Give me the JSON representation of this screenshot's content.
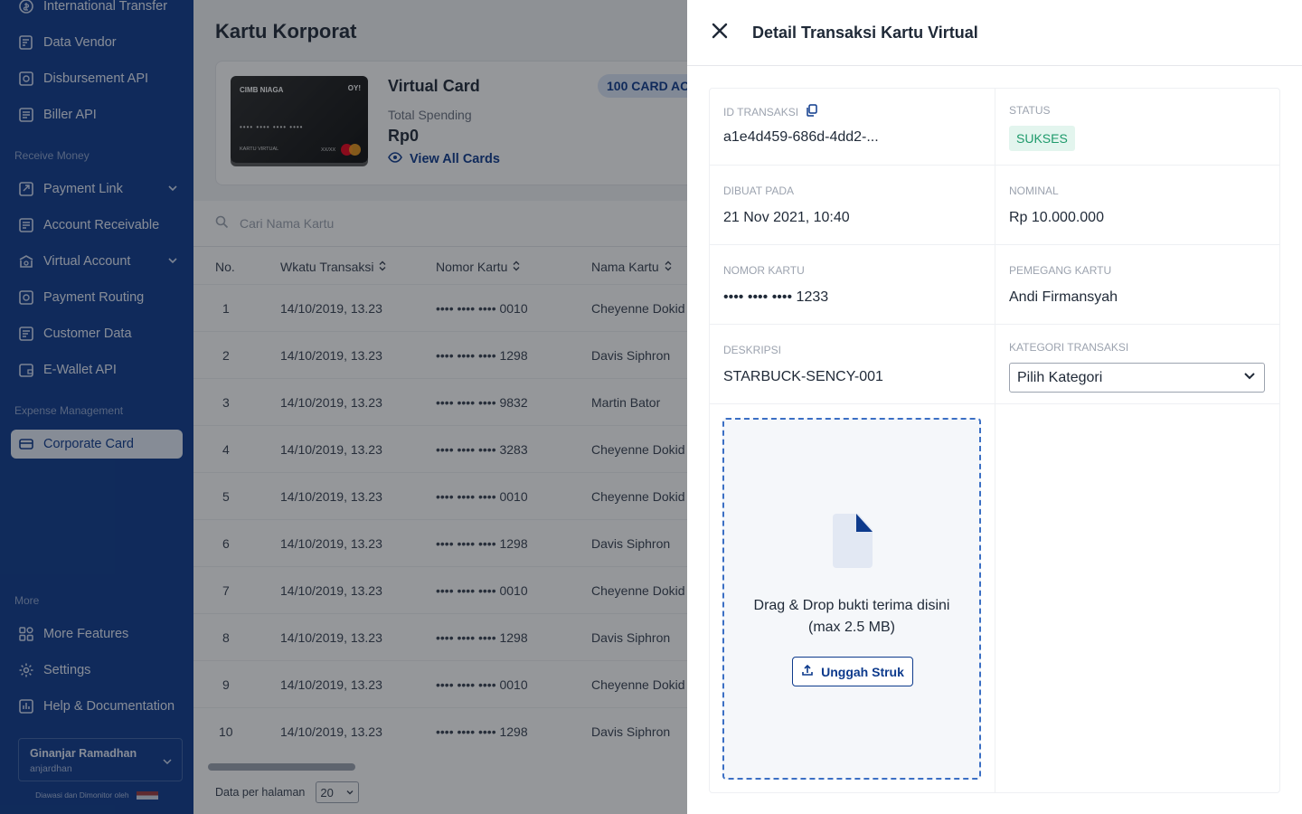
{
  "sidebar": {
    "items_top": [
      {
        "label": "International Transfer",
        "icon": "transfer-icon"
      },
      {
        "label": "Data Vendor",
        "icon": "vendor-icon"
      },
      {
        "label": "Disbursement API",
        "icon": "api-icon"
      },
      {
        "label": "Biller API",
        "icon": "biller-icon"
      }
    ],
    "section_receive": "Receive Money",
    "items_receive": [
      {
        "label": "Payment Link",
        "icon": "link-icon"
      },
      {
        "label": "Account Receivable",
        "icon": "receivable-icon"
      },
      {
        "label": "Virtual Account",
        "icon": "virtual-account-icon"
      },
      {
        "label": "Payment Routing",
        "icon": "routing-icon"
      },
      {
        "label": "Customer Data",
        "icon": "customer-icon"
      },
      {
        "label": "E-Wallet API",
        "icon": "wallet-icon"
      }
    ],
    "section_expense": "Expense Management",
    "active_item": {
      "label": "Corporate Card",
      "icon": "card-icon"
    },
    "section_more": "More",
    "items_more": [
      {
        "label": "More Features",
        "icon": "grid-icon"
      },
      {
        "label": "Settings",
        "icon": "gear-icon"
      },
      {
        "label": "Help & Documentation",
        "icon": "help-icon"
      }
    ],
    "user": {
      "name": "Ginanjar Ramadhan",
      "handle": "anjardhan"
    },
    "monitor_text": "Diawasi dan Dimonitor oleh"
  },
  "main": {
    "title": "Kartu Korporat",
    "card": {
      "brand": "CIMB NIAGA",
      "issuer": "OY!",
      "number_mask": "•••• •••• •••• ••••",
      "label": "KARTU VIRTUAL",
      "expiry": "XX/XX",
      "title": "Virtual Card",
      "badge": "100 CARD AC",
      "spending_label": "Total Spending",
      "spending_value": "Rp0",
      "view_all": "View All Cards"
    },
    "search_placeholder": "Cari Nama Kartu",
    "columns": [
      "No.",
      "Wkatu Transaksi",
      "Nomor Kartu",
      "Nama Kartu"
    ],
    "rows": [
      {
        "no": "1",
        "time": "14/10/2019, 13.23",
        "card": "•••• •••• •••• 0010",
        "name": "Cheyenne Dokid"
      },
      {
        "no": "2",
        "time": "14/10/2019, 13.23",
        "card": "•••• •••• •••• 1298",
        "name": "Davis Siphron"
      },
      {
        "no": "3",
        "time": "14/10/2019, 13.23",
        "card": "•••• •••• •••• 9832",
        "name": "Martin Bator"
      },
      {
        "no": "4",
        "time": "14/10/2019, 13.23",
        "card": "•••• •••• •••• 3283",
        "name": "Cheyenne Dokid"
      },
      {
        "no": "5",
        "time": "14/10/2019, 13.23",
        "card": "•••• •••• •••• 0010",
        "name": "Cheyenne Dokid"
      },
      {
        "no": "6",
        "time": "14/10/2019, 13.23",
        "card": "•••• •••• •••• 1298",
        "name": "Davis Siphron"
      },
      {
        "no": "7",
        "time": "14/10/2019, 13.23",
        "card": "•••• •••• •••• 0010",
        "name": "Cheyenne Dokid"
      },
      {
        "no": "8",
        "time": "14/10/2019, 13.23",
        "card": "•••• •••• •••• 1298",
        "name": "Davis Siphron"
      },
      {
        "no": "9",
        "time": "14/10/2019, 13.23",
        "card": "•••• •••• •••• 0010",
        "name": "Cheyenne Dokid"
      },
      {
        "no": "10",
        "time": "14/10/2019, 13.23",
        "card": "•••• •••• •••• 1298",
        "name": "Davis Siphron"
      }
    ],
    "per_page_label": "Data per halaman",
    "per_page_value": "20"
  },
  "drawer": {
    "title": "Detail Transaksi Kartu Virtual",
    "id_label": "ID TRANSAKSI",
    "id_value": "a1e4d459-686d-4dd2-...",
    "status_label": "STATUS",
    "status_value": "SUKSES",
    "created_label": "DIBUAT PADA",
    "created_value": "21 Nov 2021, 10:40",
    "nominal_label": "NOMINAL",
    "nominal_value": "Rp 10.000.000",
    "card_label": "NOMOR KARTU",
    "card_value": "•••• •••• •••• 1233",
    "holder_label": "PEMEGANG KARTU",
    "holder_value": "Andi Firmansyah",
    "desc_label": "DESKRIPSI",
    "desc_value": "STARBUCK-SENCY-001",
    "category_label": "KATEGORI TRANSAKSI",
    "category_value": "Pilih Kategori",
    "drop_text_1": "Drag & Drop bukti terima disini",
    "drop_text_2": "(max 2.5 MB)",
    "upload_label": "Unggah Struk"
  },
  "colors": {
    "sidebar_bg": "#0d3a8c",
    "accent": "#0d3a8c",
    "success_bg": "#e3f5ee",
    "success_text": "#1e9a6b"
  }
}
